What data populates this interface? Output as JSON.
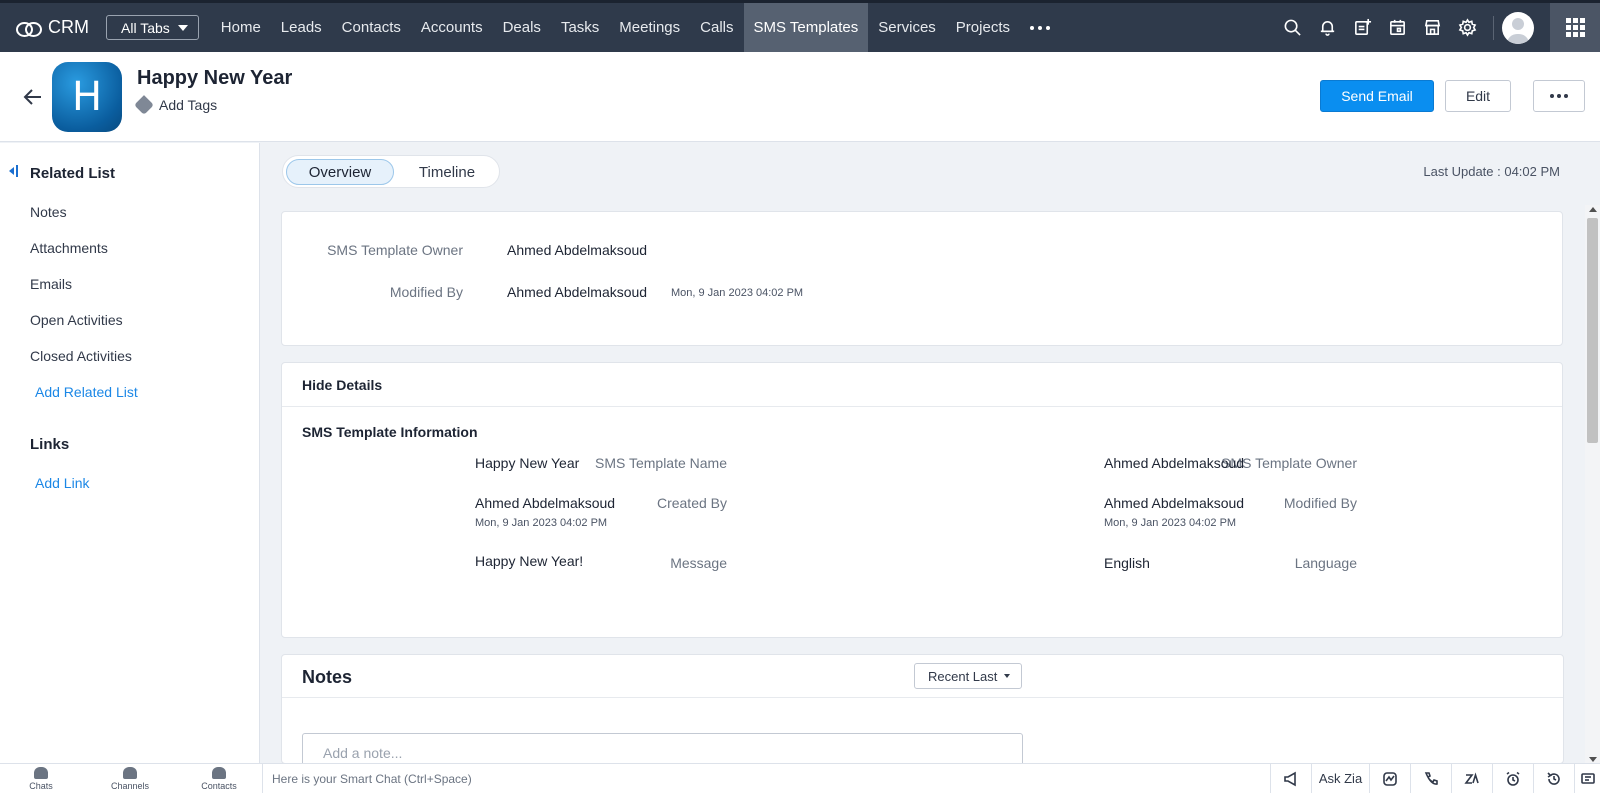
{
  "app": {
    "name": "CRM"
  },
  "nav": {
    "all_tabs": "All Tabs",
    "tabs": [
      "Home",
      "Leads",
      "Contacts",
      "Accounts",
      "Deals",
      "Tasks",
      "Meetings",
      "Calls",
      "SMS Templates",
      "Services",
      "Projects"
    ],
    "active_tab": "SMS Templates"
  },
  "record": {
    "avatar_letter": "H",
    "title": "Happy New Year",
    "add_tags": "Add Tags",
    "send_email": "Send Email",
    "edit": "Edit"
  },
  "sidebar": {
    "related_list_title": "Related List",
    "items": [
      "Notes",
      "Attachments",
      "Emails",
      "Open Activities",
      "Closed Activities"
    ],
    "add_related_list": "Add Related List",
    "links_title": "Links",
    "add_link": "Add Link"
  },
  "main": {
    "tabs": {
      "overview": "Overview",
      "timeline": "Timeline"
    },
    "last_update": "Last Update : 04:02 PM",
    "summary": {
      "owner_label": "SMS Template Owner",
      "owner_value": "Ahmed Abdelmaksoud",
      "modified_label": "Modified By",
      "modified_value": "Ahmed Abdelmaksoud",
      "modified_time": "Mon, 9 Jan 2023 04:02 PM"
    },
    "details": {
      "hide_details": "Hide Details",
      "section_title": "SMS Template Information",
      "name_label": "SMS Template Name",
      "name_value": "Happy New Year",
      "owner_label": "SMS Template Owner",
      "owner_value": "Ahmed Abdelmaksoud",
      "created_label": "Created By",
      "created_value": "Ahmed Abdelmaksoud",
      "created_time": "Mon, 9 Jan 2023 04:02 PM",
      "modified_label": "Modified By",
      "modified_value": "Ahmed Abdelmaksoud",
      "modified_time": "Mon, 9 Jan 2023 04:02 PM",
      "message_label": "Message",
      "message_value": "Happy New Year!",
      "language_label": "Language",
      "language_value": "English"
    },
    "notes": {
      "title": "Notes",
      "sort": "Recent Last",
      "placeholder": "Add a note..."
    }
  },
  "bottombar": {
    "chats": "Chats",
    "channels": "Channels",
    "contacts": "Contacts",
    "smart_chat": "Here is your Smart Chat (Ctrl+Space)",
    "ask_zia": "Ask Zia"
  },
  "colors": {
    "primary": "#0a8ef0",
    "topbar": "#2f3a4b",
    "active_tab": "#566171",
    "link": "#1b87e6"
  }
}
